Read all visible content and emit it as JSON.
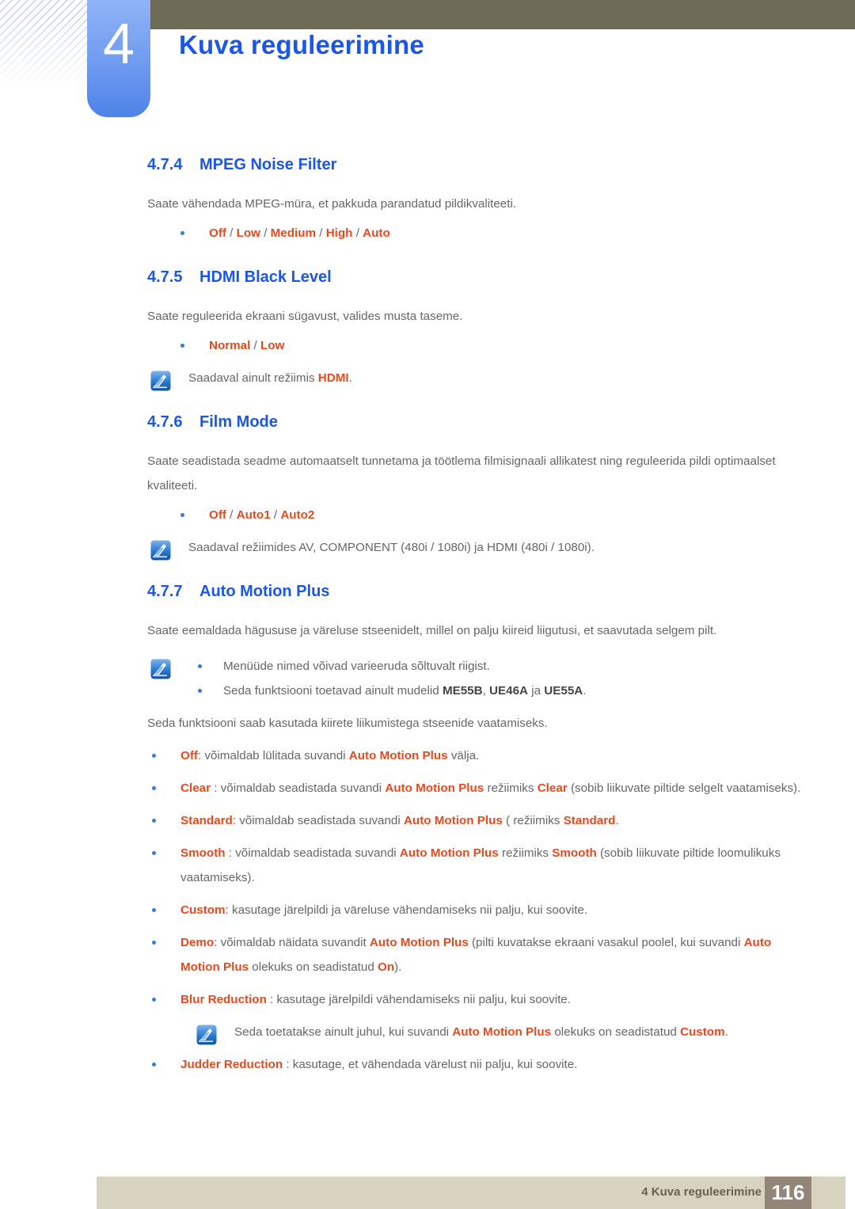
{
  "header": {
    "chapter_number": "4",
    "chapter_title": "Kuva reguleerimine",
    "accent_blue": "#1a56e8",
    "olive": "#6d6a55"
  },
  "sections": [
    {
      "num": "4.7.4",
      "title": "MPEG Noise Filter",
      "intro": "Saate vähendada MPEG-müra, et pakkuda parandatud pildikvaliteeti.",
      "options": [
        "Off",
        "Low",
        "Medium",
        "High",
        "Auto"
      ]
    },
    {
      "num": "4.7.5",
      "title": "HDMI Black Level",
      "intro": "Saate reguleerida ekraani sügavust, valides musta taseme.",
      "options": [
        "Normal",
        "Low"
      ],
      "note_a": "Saadaval ainult režiimis ",
      "note_a_hl": "HDMI",
      "note_a_end": "."
    },
    {
      "num": "4.7.6",
      "title": "Film Mode",
      "intro": "Saate seadistada seadme automaatselt tunnetama ja töötlema filmisignaali allikatest ning reguleerida pildi optimaalset kvaliteeti.",
      "options": [
        "Off",
        "Auto1",
        "Auto2"
      ],
      "note": "Saadaval režiimides AV, COMPONENT (480i / 1080i) ja HDMI (480i / 1080i)."
    },
    {
      "num": "4.7.7",
      "title": "Auto Motion Plus",
      "intro": "Saate eemaldada hägususe ja väreluse stseenidelt, millel on palju kiireid liigutusi, et saavutada selgem pilt.",
      "note_bullets": [
        {
          "text": "Menüüde nimed võivad varieeruda sõltuvalt riigist."
        },
        {
          "pre": "Seda funktsiooni toetavad ainult mudelid ",
          "m1": "ME55B",
          "mid1": ", ",
          "m2": "UE46A",
          "mid2": " ja ",
          "m3": "UE55A",
          "post": "."
        }
      ],
      "body": "Seda funktsiooni saab kasutada kiirete liikumistega stseenide vaatamiseks."
    }
  ],
  "amp_items": [
    {
      "term": "Off",
      "t1": ": võimaldab lülitada suvandi ",
      "h1": "Auto Motion Plus",
      "t2": " välja."
    },
    {
      "term": "Clear",
      "t1": " : võimaldab seadistada suvandi ",
      "h1": "Auto Motion Plus",
      "t2": " režiimiks ",
      "h2": "Clear",
      "t3": " (sobib liikuvate piltide selgelt vaatamiseks)."
    },
    {
      "term": "Standard",
      "t1": ": võimaldab seadistada suvandi ",
      "h1": "Auto Motion Plus",
      "t2": " ( režiimiks ",
      "h2": "Standard",
      "t3": "."
    },
    {
      "term": "Smooth",
      "t1": " : võimaldab seadistada suvandi ",
      "h1": "Auto Motion Plus",
      "t2": " režiimiks ",
      "h2": "Smooth",
      "t3": " (sobib liikuvate piltide loomulikuks vaatamiseks)."
    },
    {
      "term": "Custom",
      "t1": ": kasutage järelpildi ja väreluse vähendamiseks nii palju, kui soovite."
    },
    {
      "term": "Demo",
      "t1": ": võimaldab näidata suvandit ",
      "h1": "Auto Motion Plus",
      "t2": " (pilti kuvatakse ekraani vasakul poolel, kui suvandi ",
      "h2": "Auto Motion Plus",
      "t3": " olekuks on seadistatud ",
      "h3": "On",
      "t4": ")."
    },
    {
      "term": "Blur Reduction",
      "t1": " : kasutage järelpildi vähendamiseks nii palju, kui soovite."
    },
    {
      "term": "Judder Reduction",
      "t1": " : kasutage, et vähendada värelust nii palju, kui soovite."
    }
  ],
  "custom_note": {
    "pre": "Seda toetatakse ainult juhul, kui suvandi ",
    "h1": "Auto Motion Plus",
    "mid": " olekuks on seadistatud ",
    "h2": "Custom",
    "post": "."
  },
  "footer": {
    "label": "4 Kuva reguleerimine",
    "page": "116",
    "bar_color": "#d8d2c0",
    "page_box_color": "#938578"
  },
  "icons": {
    "note": "note-pencil-icon"
  }
}
